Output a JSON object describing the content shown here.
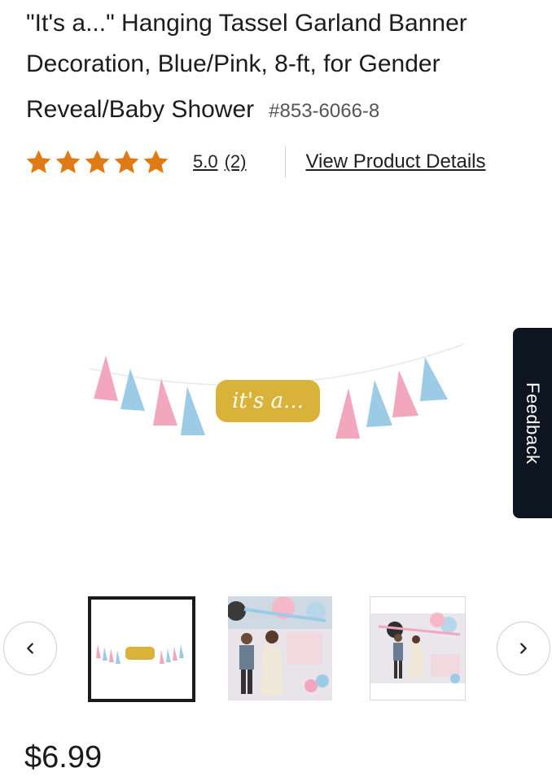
{
  "product": {
    "title_line1": "\"It's a...\" Hanging Tassel Garland Banner",
    "title_line2": "Decoration, Blue/Pink, 8-ft, for Gender",
    "title_line3": "Reveal/Baby Shower",
    "sku": "#853-6066-8",
    "banner_text": "it's a...",
    "price": "$6.99"
  },
  "rating": {
    "value": "5.0",
    "count": "(2)",
    "stars_filled": 5,
    "stars_total": 5,
    "star_color": "#e07a14"
  },
  "links": {
    "view_details": "View Product Details"
  },
  "feedback": {
    "label": "Feedback"
  },
  "gallery": {
    "prev_icon": "chevron-left-icon",
    "next_icon": "chevron-right-icon",
    "selected_index": 0,
    "thumbnails": [
      "garland-image",
      "couple-party-photo",
      "party-backdrop-photo"
    ]
  },
  "colors": {
    "pink": "#f2a7be",
    "blue": "#9ccbe6",
    "gold": "#d9b23a",
    "feedback_bg": "#0d1620"
  }
}
